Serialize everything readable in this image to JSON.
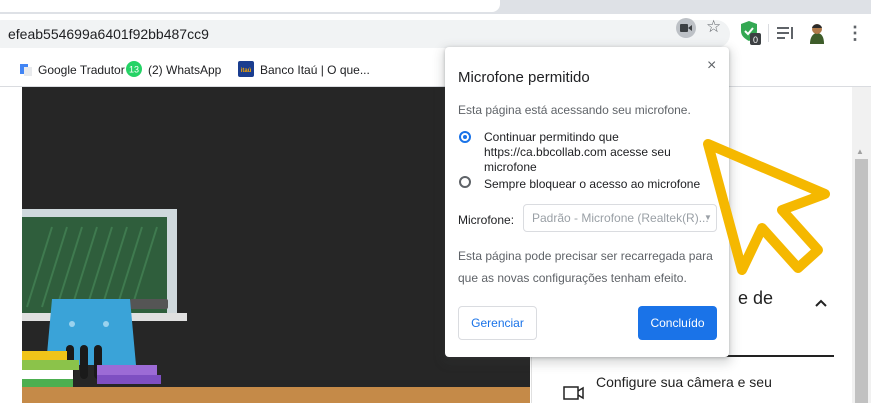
{
  "browser": {
    "url": "efeab554699a6401f92bb487cc9",
    "bookmarks": [
      {
        "label": "Google Tradutor",
        "icon": "google-translate-icon"
      },
      {
        "label": "(2) WhatsApp",
        "icon": "whatsapp-icon",
        "badge": "13"
      },
      {
        "label": "Banco Itaú | O que...",
        "icon": "itau-icon",
        "icon_text": "itaú"
      }
    ],
    "extension_badge": "0",
    "menu_icon": "⋮"
  },
  "popup": {
    "title": "Microfone permitido",
    "close": "×",
    "description": "Esta página está acessando seu microfone.",
    "options": [
      {
        "label": "Continuar permitindo que https://ca.bbcollab.com acesse seu microfone",
        "selected": true
      },
      {
        "label": "Sempre bloquear o acesso ao microfone",
        "selected": false
      }
    ],
    "mic_label": "Microfone:",
    "mic_value": "Padrão - Microfone (Realtek(R)...",
    "note": "Esta página pode precisar ser recarregada para que as novas configurações tenham efeito.",
    "manage_button": "Gerenciar",
    "done_button": "Concluído"
  },
  "page": {
    "card_heading": "e de",
    "card_text_1": "Configure sua câmera e seu"
  },
  "colors": {
    "accent": "#1a73e8",
    "cursor": "#f5b800",
    "dark_panel": "#262626"
  }
}
